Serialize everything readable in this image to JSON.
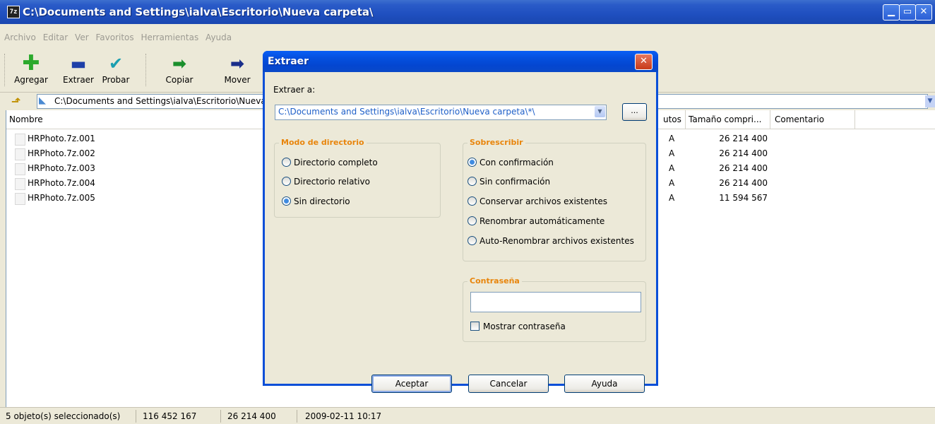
{
  "window": {
    "title": "C:\\Documents and Settings\\ialva\\Escritorio\\Nueva carpeta\\",
    "app_icon_text": "7z",
    "controls": [
      "minimize",
      "maximize",
      "close"
    ]
  },
  "menu": [
    "Archivo",
    "Editar",
    "Ver",
    "Favoritos",
    "Herramientas",
    "Ayuda"
  ],
  "toolbar": {
    "buttons": [
      {
        "label": "Agregar",
        "icon": "plus-icon",
        "color": "#2ca92c"
      },
      {
        "label": "Extraer",
        "icon": "minus-icon",
        "color": "#1e3fa8"
      },
      {
        "label": "Probar",
        "icon": "check-icon",
        "color": "#1b9fb0"
      },
      {
        "label": "Copiar",
        "icon": "copy-arrow-icon",
        "color": "#1b8f2c"
      },
      {
        "label": "Mover",
        "icon": "move-arrow-icon",
        "color": "#1a2e8a"
      }
    ]
  },
  "address": {
    "path": "C:\\Documents and Settings\\ialva\\Escritorio\\Nueva"
  },
  "list": {
    "columns": [
      "Nombre",
      "utos",
      "Tamaño compri...",
      "Comentario"
    ],
    "rows": [
      {
        "name": "HRPhoto.7z.001",
        "attr": "A",
        "size": "26 214 400"
      },
      {
        "name": "HRPhoto.7z.002",
        "attr": "A",
        "size": "26 214 400"
      },
      {
        "name": "HRPhoto.7z.003",
        "attr": "A",
        "size": "26 214 400"
      },
      {
        "name": "HRPhoto.7z.004",
        "attr": "A",
        "size": "26 214 400"
      },
      {
        "name": "HRPhoto.7z.005",
        "attr": "A",
        "size": "11 594 567"
      }
    ]
  },
  "status": {
    "selected": "5 objeto(s) seleccionado(s)",
    "total": "116 452 167",
    "item_size": "26 214 400",
    "date": "2009-02-11 10:17"
  },
  "dialog": {
    "title": "Extraer",
    "close_symbol": "✕",
    "extract_to_label": "Extraer a:",
    "extract_to_value": "C:\\Documents and Settings\\ialva\\Escritorio\\Nueva carpeta\\*\\",
    "browse_label": "...",
    "dir_mode": {
      "title": "Modo de directorio",
      "options": [
        "Directorio completo",
        "Directorio relativo",
        "Sin directorio"
      ],
      "selected": "Sin directorio"
    },
    "overwrite": {
      "title": "Sobrescribir",
      "options": [
        "Con confirmación",
        "Sin confirmación",
        "Conservar archivos existentes",
        "Renombrar automáticamente",
        "Auto-Renombrar archivos existentes"
      ],
      "selected": "Con confirmación"
    },
    "password": {
      "title": "Contraseña",
      "value": "",
      "show_label": "Mostrar contraseña",
      "show_checked": false
    },
    "buttons": {
      "ok": "Aceptar",
      "cancel": "Cancelar",
      "help": "Ayuda"
    }
  }
}
